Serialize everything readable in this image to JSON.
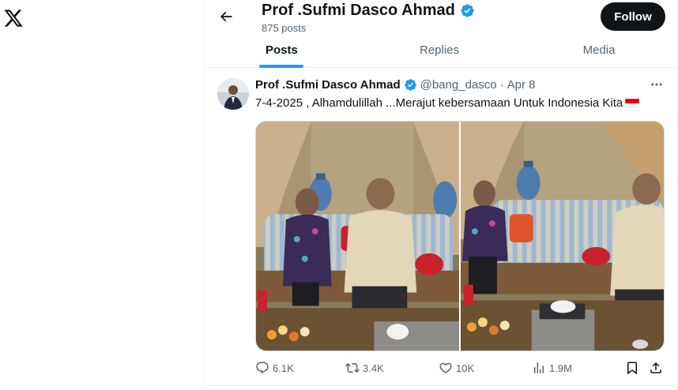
{
  "header": {
    "profile_name": "Prof .Sufmi Dasco Ahmad",
    "post_count": "875 posts",
    "follow_label": "Follow"
  },
  "tabs": [
    {
      "label": "Posts",
      "active": true
    },
    {
      "label": "Replies",
      "active": false
    },
    {
      "label": "Media",
      "active": false
    }
  ],
  "tweet": {
    "author": "Prof .Sufmi Dasco Ahmad",
    "handle": "@bang_dasco",
    "separator": "·",
    "date": "Apr 8",
    "text": "7-4-2025 , Alhamdulillah ...Merajut kebersamaan Untuk Indonesia Kita",
    "emoji": "indonesia-flag",
    "stats": {
      "replies": "6.1K",
      "reposts": "3.4K",
      "likes": "10K",
      "views": "1.9M"
    }
  },
  "icons": {
    "logo": "x-logo",
    "back": "arrow-left-icon",
    "verified": "verified-badge-icon",
    "more": "more-horizontal-icon",
    "reply": "reply-icon",
    "repost": "repost-icon",
    "like": "heart-icon",
    "views": "views-icon",
    "bookmark": "bookmark-icon",
    "share": "share-icon"
  },
  "colors": {
    "accent": "#1d9bf0",
    "text_primary": "#0f1419",
    "text_secondary": "#536471",
    "follow_bg": "#0f1419"
  }
}
